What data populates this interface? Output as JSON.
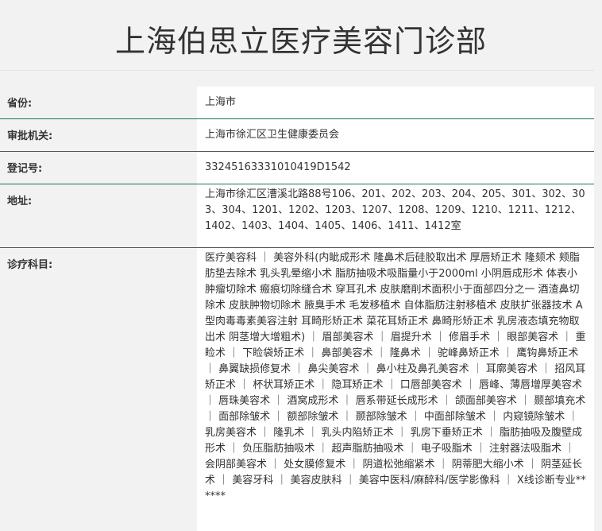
{
  "title": "上海伯思立医疗美容门诊部",
  "rows": [
    {
      "label": "省份:",
      "value": "上海市"
    },
    {
      "label": "审批机关:",
      "value": "上海市徐汇区卫生健康委员会"
    },
    {
      "label": "登记号:",
      "value": "33245163331010419D1542"
    },
    {
      "label": "地址:",
      "value": "上海市徐汇区漕溪北路88号106、201、202、203、204、205、301、302、303、304、1201、1202、1203、1207、1208、1209、1210、1211、1212、1402、1403、1404、1405、1406、1411、1412室"
    },
    {
      "label": "诊疗科目:",
      "value": "医疗美容科 ｜ 美容外科(内眦成形术 隆鼻术后硅胶取出术 厚唇矫正术 隆颏术 颊脂肪垫去除术 乳头乳晕缩小术 脂肪抽吸术吸脂量小于2000ml 小阴唇成形术 体表小肿瘤切除术 瘢痕切除缝合术 穿耳孔术 皮肤磨削术面积小于面部四分之一 酒渣鼻切除术 皮肤肿物切除术 腋臭手术 毛发移植术 自体脂肪注射移植术 皮肤扩张器技术 A型肉毒毒素美容注射 耳畸形矫正术 菜花耳矫正术 鼻畸形矫正术 乳房液态填充物取出术 阴茎增大增粗术) ｜ 眉部美容术 ｜ 眉提升术 ｜ 修眉手术 ｜ 眼部美容术 ｜ 重睑术 ｜ 下睑袋矫正术 ｜ 鼻部美容术 ｜ 隆鼻术 ｜ 驼峰鼻矫正术 ｜ 鹰钩鼻矫正术 ｜ 鼻翼缺损修复术 ｜ 鼻尖美容术 ｜ 鼻小柱及鼻孔美容术 ｜ 耳廓美容术 ｜ 招风耳矫正术 ｜ 杯状耳矫正术 ｜ 隐耳矫正术 ｜ 口唇部美容术 ｜ 唇峰、薄唇增厚美容术 ｜ 唇珠美容术 ｜ 酒窝成形术 ｜ 唇系带延长成形术 ｜ 颌面部美容术 ｜ 颞部填充术 ｜ 面部除皱术 ｜ 额部除皱术 ｜ 颞部除皱术 ｜ 中面部除皱术 ｜ 内窥镜除皱术 ｜ 乳房美容术 ｜ 隆乳术 ｜ 乳头内陷矫正术 ｜ 乳房下垂矫正术 ｜ 脂肪抽吸及腹壁成形术 ｜ 负压脂肪抽吸术 ｜ 超声脂肪抽吸术 ｜ 电子吸脂术 ｜ 注射器法吸脂术 ｜ 会阴部美容术 ｜ 处女膜修复术 ｜ 阴道松弛缩紧术 ｜ 阴蒂肥大缩小术 ｜ 阴茎延长术 ｜ 美容牙科 ｜ 美容皮肤科 ｜ 美容中医科/麻醉科/医学影像科 ｜ X线诊断专业******"
    }
  ]
}
